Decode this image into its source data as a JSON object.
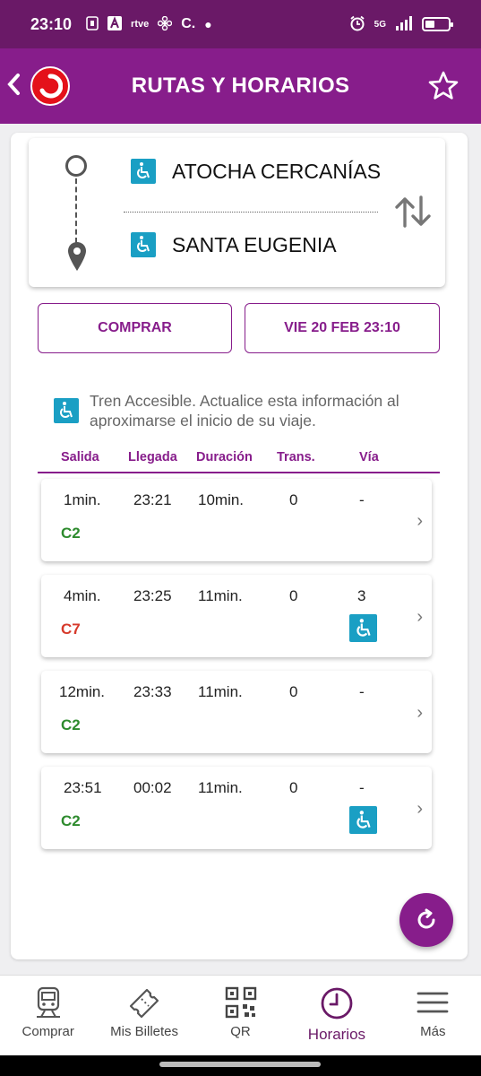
{
  "status_bar": {
    "time": "23:10",
    "icons": [
      "madrid-icon",
      "a-icon",
      "rtve-play-icon",
      "fan-icon",
      "c-icon",
      "dot-icon"
    ],
    "rtve_label": "rtve",
    "network": "5G",
    "right_icons": [
      "alarm-icon",
      "signal-icon",
      "battery-icon"
    ]
  },
  "header": {
    "title": "RUTAS Y HORARIOS",
    "back_icon": "chevron-left-icon",
    "favorite_icon": "star-outline-icon"
  },
  "route": {
    "origin": "ATOCHA CERCANÍAS",
    "destination": "SANTA EUGENIA",
    "swap_icon": "swap-vertical-icon"
  },
  "actions": {
    "buy_label": "COMPRAR",
    "date_label": "VIE 20 FEB 23:10"
  },
  "notice": {
    "text": "Tren Accesible. Actualice esta información al aproximarse el inicio de su viaje."
  },
  "columns": [
    "Salida",
    "Llegada",
    "Duración",
    "Trans.",
    "Vía"
  ],
  "trips": [
    {
      "departure": "1min.",
      "arrival": "23:21",
      "duration": "10min.",
      "transfers": "0",
      "platform": "-",
      "line": "C2",
      "line_color": "#2e8b2e",
      "accessible": false
    },
    {
      "departure": "4min.",
      "arrival": "23:25",
      "duration": "11min.",
      "transfers": "0",
      "platform": "3",
      "line": "C7",
      "line_color": "#d63a2b",
      "accessible": true
    },
    {
      "departure": "12min.",
      "arrival": "23:33",
      "duration": "11min.",
      "transfers": "0",
      "platform": "-",
      "line": "C2",
      "line_color": "#2e8b2e",
      "accessible": false
    },
    {
      "departure": "23:51",
      "arrival": "00:02",
      "duration": "11min.",
      "transfers": "0",
      "platform": "-",
      "line": "C2",
      "line_color": "#2e8b2e",
      "accessible": true
    }
  ],
  "bottom_nav": [
    {
      "label": "Comprar",
      "icon": "train-icon"
    },
    {
      "label": "Mis Billetes",
      "icon": "ticket-icon"
    },
    {
      "label": "QR",
      "icon": "qr-code-icon"
    },
    {
      "label": "Horarios",
      "icon": "clock-icon",
      "active": true
    },
    {
      "label": "Más",
      "icon": "menu-icon"
    }
  ],
  "colors": {
    "brand": "#871d8b",
    "status_bar": "#6a1967",
    "accessible": "#1a9fc4"
  }
}
